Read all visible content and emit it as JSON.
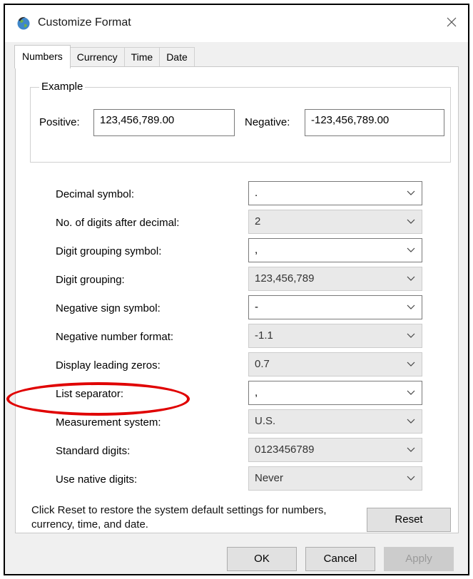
{
  "window": {
    "title": "Customize Format",
    "app_icon": "region-globe-icon",
    "close_icon": "close-icon"
  },
  "tabs": [
    {
      "label": "Numbers",
      "active": true
    },
    {
      "label": "Currency",
      "active": false
    },
    {
      "label": "Time",
      "active": false
    },
    {
      "label": "Date",
      "active": false
    }
  ],
  "example": {
    "group_label": "Example",
    "positive_label": "Positive:",
    "positive_value": "123,456,789.00",
    "negative_label": "Negative:",
    "negative_value": "-123,456,789.00"
  },
  "settings": [
    {
      "label": "Decimal symbol:",
      "value": ".",
      "editable": true
    },
    {
      "label": "No. of digits after decimal:",
      "value": "2",
      "editable": false
    },
    {
      "label": "Digit grouping symbol:",
      "value": ",",
      "editable": true
    },
    {
      "label": "Digit grouping:",
      "value": "123,456,789",
      "editable": false
    },
    {
      "label": "Negative sign symbol:",
      "value": "-",
      "editable": true
    },
    {
      "label": "Negative number format:",
      "value": "-1.1",
      "editable": false
    },
    {
      "label": "Display leading zeros:",
      "value": "0.7",
      "editable": false
    },
    {
      "label": "List separator:",
      "value": ",",
      "editable": true
    },
    {
      "label": "Measurement system:",
      "value": "U.S.",
      "editable": false
    },
    {
      "label": "Standard digits:",
      "value": "0123456789",
      "editable": false
    },
    {
      "label": "Use native digits:",
      "value": "Never",
      "editable": false
    }
  ],
  "footer": {
    "note": "Click Reset to restore the system default settings for numbers, currency, time, and date.",
    "reset_label": "Reset",
    "ok_label": "OK",
    "cancel_label": "Cancel",
    "apply_label": "Apply"
  },
  "annotation": {
    "highlight_color": "#e00000",
    "highlighted_setting": "List separator:"
  },
  "colors": {
    "panel_bg": "#ffffff",
    "dialog_bg": "#f0f0f0",
    "button_bg": "#e1e1e1"
  }
}
